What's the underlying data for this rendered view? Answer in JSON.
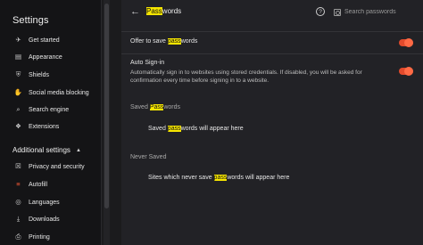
{
  "sidebar": {
    "title": "Settings",
    "items": [
      {
        "label": "Get started",
        "icon": "rocket-icon",
        "glyph": "✈"
      },
      {
        "label": "Appearance",
        "icon": "appearance-icon",
        "glyph": "▤"
      },
      {
        "label": "Shields",
        "icon": "shield-icon",
        "glyph": "⛨"
      },
      {
        "label": "Social media blocking",
        "icon": "thumbs-down-icon",
        "glyph": "✋"
      },
      {
        "label": "Search engine",
        "icon": "search-engine-icon",
        "glyph": "⌕"
      },
      {
        "label": "Extensions",
        "icon": "puzzle-icon",
        "glyph": "❖"
      }
    ],
    "section_title": "Additional settings",
    "section_caret": "▲",
    "additional_items": [
      {
        "label": "Privacy and security",
        "icon": "lock-icon",
        "glyph": "☒"
      },
      {
        "label": "Autofill",
        "icon": "autofill-icon",
        "glyph": "≡",
        "active": true
      },
      {
        "label": "Languages",
        "icon": "globe-icon",
        "glyph": "◎"
      },
      {
        "label": "Downloads",
        "icon": "download-icon",
        "glyph": "⤓"
      },
      {
        "label": "Printing",
        "icon": "printer-icon",
        "glyph": "⎙"
      }
    ]
  },
  "header": {
    "back_glyph": "←",
    "title_highlight": "Pass",
    "title_rest": "words",
    "help_glyph": "?",
    "search_placeholder": "Search passwords"
  },
  "settings": {
    "offer_save": {
      "pre": "Offer to save ",
      "highlight": "pass",
      "post": "words",
      "enabled": true
    },
    "auto_signin": {
      "label": "Auto Sign-in",
      "desc_line1": "Automatically sign in to websites using stored credentials. If disabled, you will be asked for",
      "desc_line2": "confirmation every time before signing in to a website.",
      "enabled": true
    }
  },
  "saved": {
    "head_pre": "Saved ",
    "head_highlight": "Pass",
    "head_post": "words",
    "empty_pre": "Saved ",
    "empty_highlight": "pass",
    "empty_post": "words will appear here"
  },
  "never_saved": {
    "head": "Never Saved",
    "empty_pre": "Sites which never save ",
    "empty_highlight": "pass",
    "empty_post": "words will appear here"
  },
  "colors": {
    "accent": "#ff5b36",
    "highlight": "#f7e600",
    "background": "#222226"
  }
}
